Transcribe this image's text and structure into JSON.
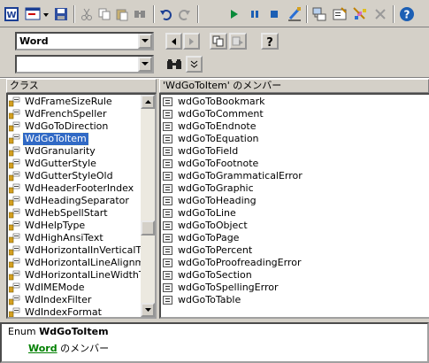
{
  "toolbar": {
    "buttons": [
      {
        "name": "word-app-icon"
      },
      {
        "name": "insert-userform-icon"
      },
      {
        "name": "save-icon"
      },
      {
        "name": "cut-icon"
      },
      {
        "name": "copy-icon"
      },
      {
        "name": "paste-icon"
      },
      {
        "name": "find-icon"
      },
      {
        "name": "undo-icon"
      },
      {
        "name": "redo-icon"
      },
      {
        "name": "run-icon"
      },
      {
        "name": "break-icon"
      },
      {
        "name": "reset-icon"
      },
      {
        "name": "design-mode-icon"
      },
      {
        "name": "project-explorer-icon"
      },
      {
        "name": "properties-icon"
      },
      {
        "name": "object-browser-icon"
      },
      {
        "name": "toolbox-icon"
      },
      {
        "name": "help-icon"
      }
    ]
  },
  "library_combo": {
    "value": "Word"
  },
  "search_combo": {
    "value": ""
  },
  "classes_pane": {
    "header": "クラス",
    "items": [
      "WdFrameSizeRule",
      "WdFrenchSpeller",
      "WdGoToDirection",
      "WdGoToItem",
      "WdGranularity",
      "WdGutterStyle",
      "WdGutterStyleOld",
      "WdHeaderFooterIndex",
      "WdHeadingSeparator",
      "WdHebSpellStart",
      "WdHelpType",
      "WdHighAnsiText",
      "WdHorizontalInVerticalTy",
      "WdHorizontalLineAlignme",
      "WdHorizontalLineWidthTy",
      "WdIMEMode",
      "WdIndexFilter",
      "WdIndexFormat"
    ],
    "selected_index": 3
  },
  "members_pane": {
    "header": "'WdGoToItem' のメンバー",
    "items": [
      "wdGoToBookmark",
      "wdGoToComment",
      "wdGoToEndnote",
      "wdGoToEquation",
      "wdGoToField",
      "wdGoToFootnote",
      "wdGoToGrammaticalError",
      "wdGoToGraphic",
      "wdGoToHeading",
      "wdGoToLine",
      "wdGoToObject",
      "wdGoToPage",
      "wdGoToPercent",
      "wdGoToProofreadingError",
      "wdGoToSection",
      "wdGoToSpellingError",
      "wdGoToTable"
    ]
  },
  "details": {
    "prefix": "Enum ",
    "name": "WdGoToItem",
    "library_link": "Word",
    "suffix": " のメンバー"
  },
  "colors": {
    "selection": "#316ac5",
    "link": "#008000",
    "face": "#d4d0c8"
  }
}
